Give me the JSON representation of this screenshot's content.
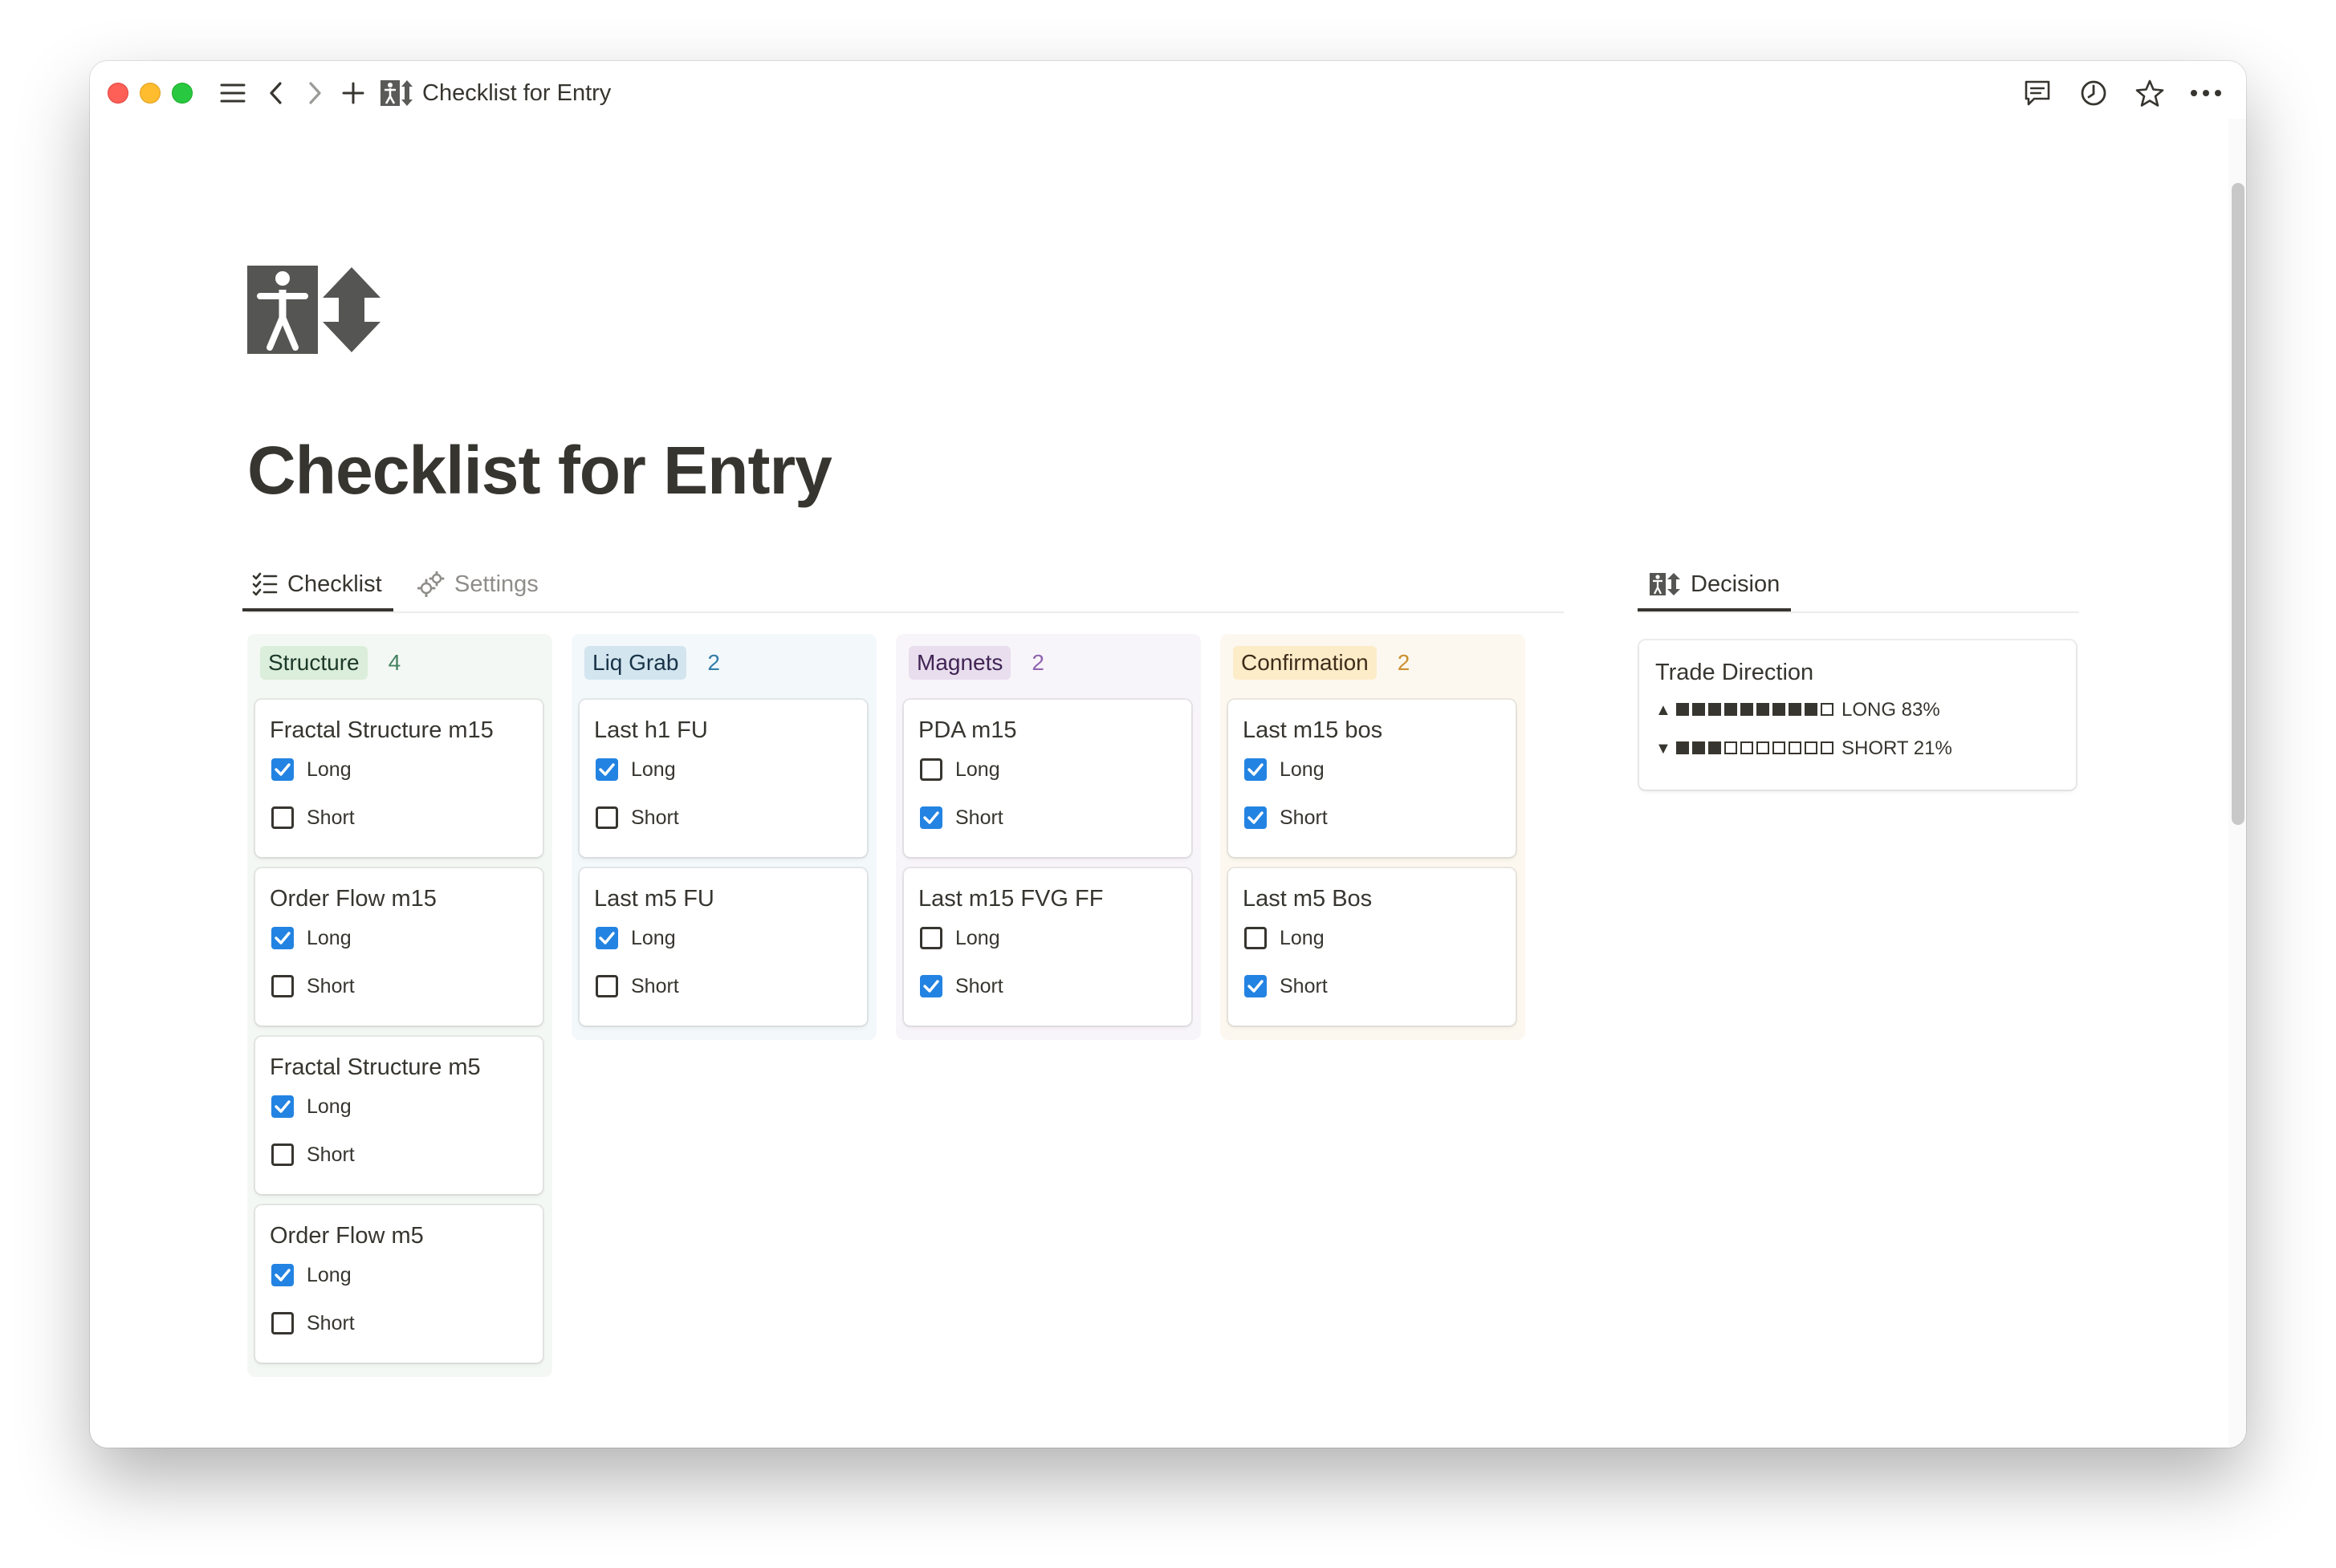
{
  "window": {
    "title": "Checklist for Entry",
    "toolbar_icons": [
      "menu-icon",
      "back-icon",
      "forward-icon",
      "plus-icon",
      "comment-icon",
      "history-icon",
      "star-icon",
      "more-icon"
    ]
  },
  "page": {
    "icon": "person-updown-icon",
    "title": "Checklist for Entry"
  },
  "tabs": {
    "checklist_label": "Checklist",
    "settings_label": "Settings",
    "decision_label": "Decision"
  },
  "columns": [
    {
      "name": "Structure",
      "count": "4",
      "tag_bg": "#dbeddb",
      "tag_color": "#1c3829",
      "count_color": "#448361",
      "col_bg": "#f4f8f4",
      "cards": [
        {
          "title": "Fractal Structure m15",
          "long": true,
          "short": false
        },
        {
          "title": "Order Flow m15",
          "long": true,
          "short": false
        },
        {
          "title": "Fractal Structure m5",
          "long": true,
          "short": false
        },
        {
          "title": "Order Flow m5",
          "long": true,
          "short": false
        }
      ]
    },
    {
      "name": "Liq Grab",
      "count": "2",
      "tag_bg": "#d3e5ef",
      "tag_color": "#183347",
      "count_color": "#337ea9",
      "col_bg": "#f3f8fb",
      "cards": [
        {
          "title": "Last h1 FU",
          "long": true,
          "short": false
        },
        {
          "title": "Last m5 FU",
          "long": true,
          "short": false
        }
      ]
    },
    {
      "name": "Magnets",
      "count": "2",
      "tag_bg": "#e8deee",
      "tag_color": "#412454",
      "count_color": "#9065b0",
      "col_bg": "#f8f5fa",
      "cards": [
        {
          "title": "PDA m15",
          "long": false,
          "short": true
        },
        {
          "title": "Last m15 FVG FF",
          "long": false,
          "short": true
        }
      ]
    },
    {
      "name": "Confirmation",
      "count": "2",
      "tag_bg": "#fdecc8",
      "tag_color": "#402c1b",
      "count_color": "#cb912f",
      "col_bg": "#fcf8f0",
      "cards": [
        {
          "title": "Last m15 bos",
          "long": true,
          "short": true
        },
        {
          "title": "Last m5 Bos",
          "long": false,
          "short": true
        }
      ]
    }
  ],
  "labels": {
    "long": "Long",
    "short": "Short"
  },
  "decision": {
    "title": "Trade Direction",
    "long": {
      "arrow": "▲",
      "filled": 9,
      "total": 10,
      "text": "LONG 83%"
    },
    "short": {
      "arrow": "▼",
      "filled": 3,
      "total": 10,
      "text": "SHORT 21%"
    }
  },
  "colors": {
    "checkbox_on": "#2383e2",
    "text": "#37352f"
  }
}
